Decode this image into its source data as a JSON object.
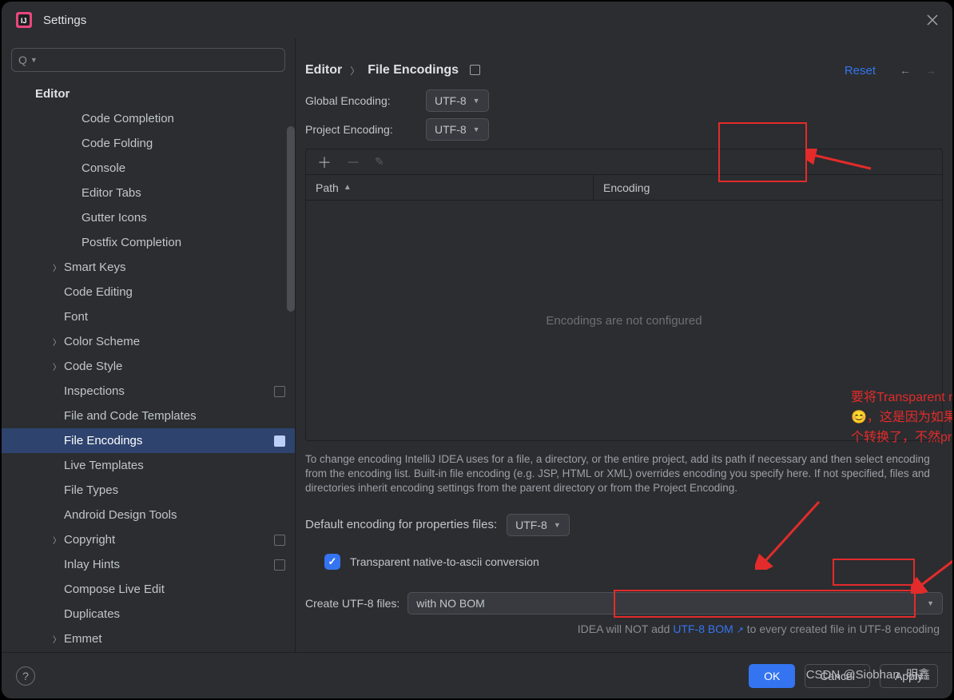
{
  "window": {
    "title": "Settings"
  },
  "search": {
    "placeholder": "Q"
  },
  "sidebar": {
    "section": "Editor",
    "items": [
      {
        "label": "Code Completion",
        "indent": 82
      },
      {
        "label": "Code Folding",
        "indent": 82
      },
      {
        "label": "Console",
        "indent": 82
      },
      {
        "label": "Editor Tabs",
        "indent": 82
      },
      {
        "label": "Gutter Icons",
        "indent": 82
      },
      {
        "label": "Postfix Completion",
        "indent": 82
      },
      {
        "label": "Smart Keys",
        "indent": 60,
        "arrow": true
      },
      {
        "label": "Code Editing",
        "indent": 60
      },
      {
        "label": "Font",
        "indent": 60
      },
      {
        "label": "Color Scheme",
        "indent": 60,
        "arrow": true
      },
      {
        "label": "Code Style",
        "indent": 60,
        "arrow": true
      },
      {
        "label": "Inspections",
        "indent": 60,
        "mod": true
      },
      {
        "label": "File and Code Templates",
        "indent": 60
      },
      {
        "label": "File Encodings",
        "indent": 60,
        "mod": true,
        "selected": true
      },
      {
        "label": "Live Templates",
        "indent": 60
      },
      {
        "label": "File Types",
        "indent": 60
      },
      {
        "label": "Android Design Tools",
        "indent": 60
      },
      {
        "label": "Copyright",
        "indent": 60,
        "arrow": true,
        "mod": true
      },
      {
        "label": "Inlay Hints",
        "indent": 60,
        "mod": true
      },
      {
        "label": "Compose Live Edit",
        "indent": 60
      },
      {
        "label": "Duplicates",
        "indent": 60
      },
      {
        "label": "Emmet",
        "indent": 60,
        "arrow": true
      }
    ]
  },
  "breadcrumb": {
    "root": "Editor",
    "leaf": "File Encodings",
    "reset": "Reset"
  },
  "encoding": {
    "global_label": "Global Encoding:",
    "global_value": "UTF-8",
    "project_label": "Project Encoding:",
    "project_value": "UTF-8"
  },
  "table": {
    "col_path": "Path",
    "col_enc": "Encoding",
    "empty": "Encodings are not configured"
  },
  "help_text": "To change encoding IntelliJ IDEA uses for a file, a directory, or the entire project, add its path if necessary and then select encoding from the encoding list. Built-in file encoding (e.g. JSP, HTML or XML) overrides encoding you specify here. If not specified, files and directories inherit encoding settings from the parent directory or from the Project Encoding.",
  "props": {
    "label": "Default encoding for properties files:",
    "value": "UTF-8",
    "checkbox_label": "Transparent native-to-ascii conversion"
  },
  "create": {
    "label": "Create UTF-8 files:",
    "value": "with NO BOM",
    "note_pre": "IDEA will NOT add ",
    "note_link": "UTF-8 BOM",
    "note_post": " to every created file in UTF-8 encoding"
  },
  "annotation": "要将Transparent native-to-ascii conversion前面的框框打上勾哟😊，这是因为如果涉及到本地的ASCII码的话，那么就能做相关的一个转换了，不然properties文件中的注释显示的都不会是中文。",
  "footer": {
    "ok": "OK",
    "cancel": "Cancel",
    "apply": "Apply"
  },
  "watermark": "CSDN @Siobhan. 明鑫"
}
